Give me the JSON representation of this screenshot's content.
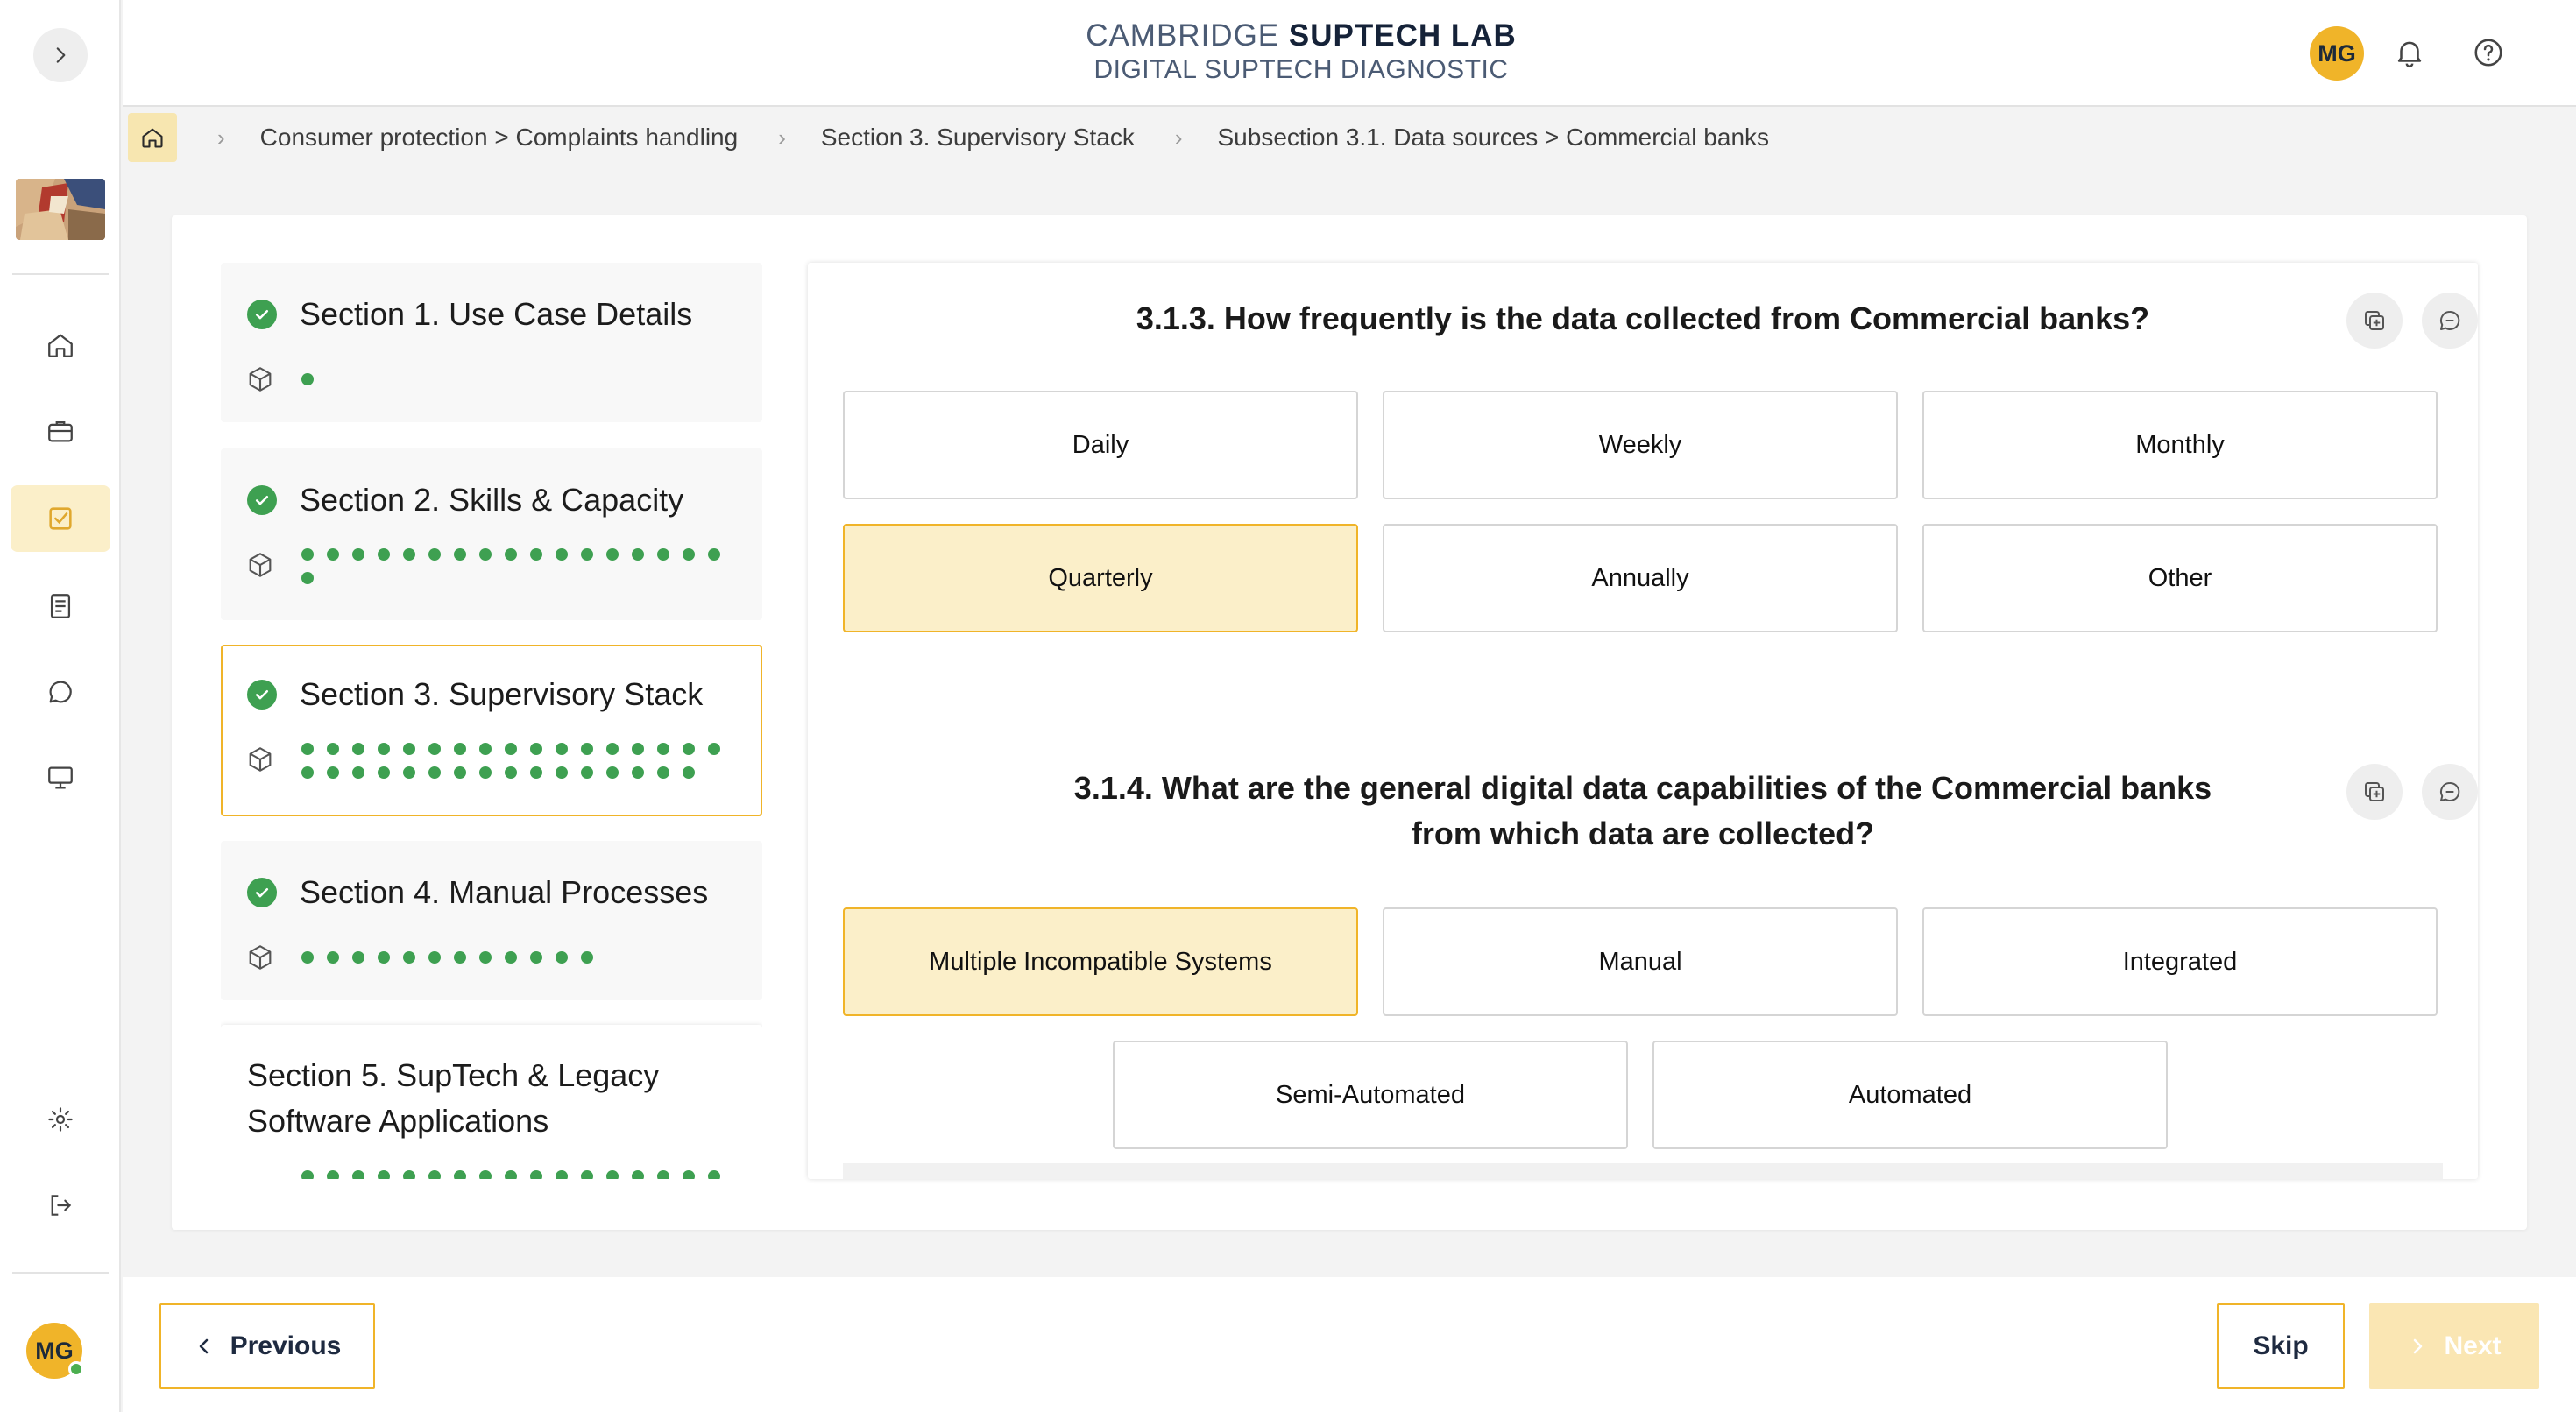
{
  "header": {
    "brand_prefix": "CAMBRIDGE",
    "brand_name": "SUPTECH LAB",
    "brand_sub": "DIGITAL SUPTECH DIAGNOSTIC",
    "user_initials": "MG"
  },
  "sidebar": {
    "user_initials": "MG",
    "active_item": "diagnostic",
    "items": [
      "home",
      "briefcase",
      "diagnostic",
      "document",
      "chat",
      "monitor",
      "settings",
      "logout"
    ]
  },
  "breadcrumb": {
    "items": [
      "Consumer protection > Complaints handling",
      "Section 3. Supervisory Stack",
      "Subsection 3.1. Data sources > Commercial banks"
    ]
  },
  "sections": [
    {
      "title": "Section 1. Use Case Details",
      "completed": true,
      "dots": 1
    },
    {
      "title": "Section 2. Skills & Capacity",
      "completed": true,
      "dots": 18
    },
    {
      "title": "Section 3. Supervisory Stack",
      "completed": true,
      "dots": 33,
      "active": true
    },
    {
      "title": "Section 4. Manual Processes",
      "completed": true,
      "dots": 12
    },
    {
      "title": "Section 5. SupTech & Legacy Software Applications",
      "completed": false,
      "dots": 17
    }
  ],
  "questions": [
    {
      "title": "3.1.3. How frequently is the data collected from Commercial banks?",
      "options": [
        "Daily",
        "Weekly",
        "Monthly",
        "Quarterly",
        "Annually",
        "Other"
      ],
      "selected": "Quarterly"
    },
    {
      "title": "3.1.4. What are the general digital data capabilities of the Commercial banks from which data are collected?",
      "options": [
        "Multiple Incompatible Systems",
        "Manual",
        "Integrated",
        "Semi-Automated",
        "Automated"
      ],
      "selected": "Multiple Incompatible Systems"
    }
  ],
  "footer": {
    "previous_label": "Previous",
    "skip_label": "Skip",
    "next_label": "Next"
  },
  "colors": {
    "accent": "#f0b429",
    "selected_bg": "#fbefc9",
    "success": "#3ea051",
    "navy": "#152238"
  }
}
